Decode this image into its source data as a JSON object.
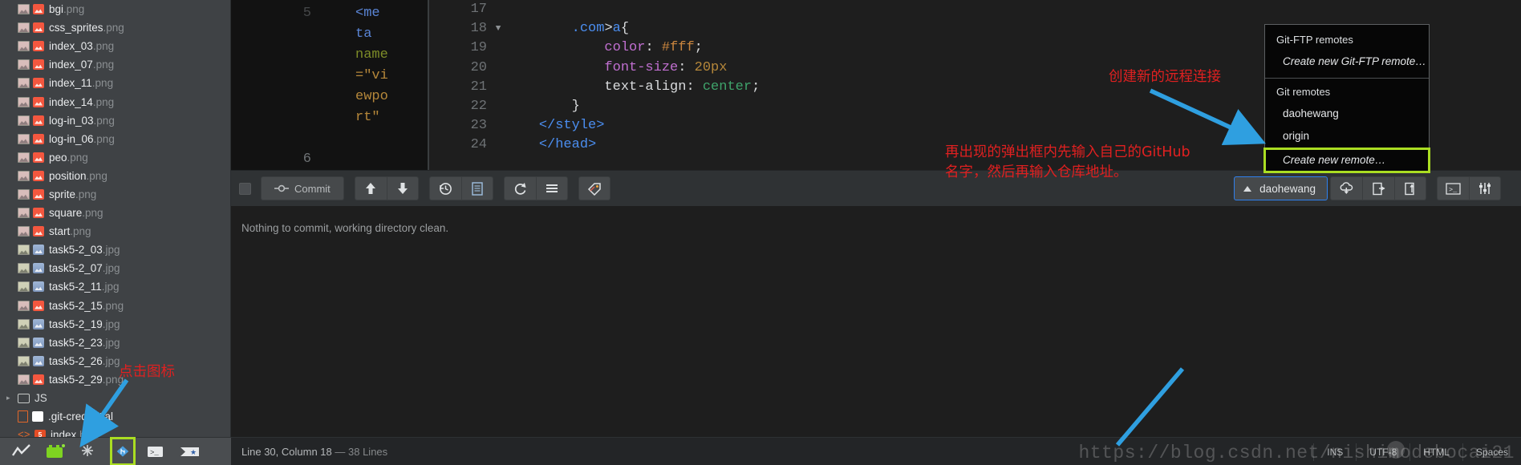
{
  "sidebar": {
    "files": [
      {
        "arrow": "",
        "icon": "image-thumb",
        "badge": "png",
        "name": "bgi",
        "ext": ".png",
        "tone": "pink"
      },
      {
        "arrow": "",
        "icon": "image-thumb",
        "badge": "png",
        "name": "css_sprites",
        "ext": ".png",
        "tone": "pink"
      },
      {
        "arrow": "",
        "icon": "image-thumb",
        "badge": "png",
        "name": "index_03",
        "ext": ".png",
        "tone": "pink"
      },
      {
        "arrow": "",
        "icon": "image-thumb",
        "badge": "png",
        "name": "index_07",
        "ext": ".png",
        "tone": "pink"
      },
      {
        "arrow": "",
        "icon": "image-thumb",
        "badge": "png",
        "name": "index_11",
        "ext": ".png",
        "tone": "pink"
      },
      {
        "arrow": "",
        "icon": "image-thumb",
        "badge": "png",
        "name": "index_14",
        "ext": ".png",
        "tone": "pink"
      },
      {
        "arrow": "",
        "icon": "image-thumb",
        "badge": "png",
        "name": "log-in_03",
        "ext": ".png",
        "tone": "pink"
      },
      {
        "arrow": "",
        "icon": "image-thumb",
        "badge": "png",
        "name": "log-in_06",
        "ext": ".png",
        "tone": "pink"
      },
      {
        "arrow": "",
        "icon": "image-thumb",
        "badge": "png",
        "name": "peo",
        "ext": ".png",
        "tone": "pink"
      },
      {
        "arrow": "",
        "icon": "image-thumb",
        "badge": "png",
        "name": "position",
        "ext": ".png",
        "tone": "pink"
      },
      {
        "arrow": "",
        "icon": "image-thumb",
        "badge": "png",
        "name": "sprite",
        "ext": ".png",
        "tone": "pink"
      },
      {
        "arrow": "",
        "icon": "image-thumb",
        "badge": "png",
        "name": "square",
        "ext": ".png",
        "tone": "pink"
      },
      {
        "arrow": "",
        "icon": "image-thumb",
        "badge": "png",
        "name": "start",
        "ext": ".png",
        "tone": "pink"
      },
      {
        "arrow": "",
        "icon": "image-thumb",
        "badge": "jpg",
        "name": "task5-2_03",
        "ext": ".jpg",
        "tone": "yellow"
      },
      {
        "arrow": "",
        "icon": "image-thumb",
        "badge": "jpg",
        "name": "task5-2_07",
        "ext": ".jpg",
        "tone": "yellow"
      },
      {
        "arrow": "",
        "icon": "image-thumb",
        "badge": "jpg",
        "name": "task5-2_11",
        "ext": ".jpg",
        "tone": "yellow"
      },
      {
        "arrow": "",
        "icon": "image-thumb",
        "badge": "png",
        "name": "task5-2_15",
        "ext": ".png",
        "tone": "pink"
      },
      {
        "arrow": "",
        "icon": "image-thumb",
        "badge": "jpg",
        "name": "task5-2_19",
        "ext": ".jpg",
        "tone": "yellow"
      },
      {
        "arrow": "",
        "icon": "image-thumb",
        "badge": "jpg",
        "name": "task5-2_23",
        "ext": ".jpg",
        "tone": "yellow"
      },
      {
        "arrow": "",
        "icon": "image-thumb",
        "badge": "jpg",
        "name": "task5-2_26",
        "ext": ".jpg",
        "tone": "yellow"
      },
      {
        "arrow": "",
        "icon": "image-thumb",
        "badge": "png",
        "name": "task5-2_29",
        "ext": ".png",
        "tone": "pink"
      }
    ],
    "folder": {
      "arrow": "▸",
      "name": "JS"
    },
    "credential": {
      "name": ".git-credential",
      "ext": ""
    },
    "index_html": {
      "name": "index",
      "ext": ".html",
      "badge_label": "5"
    },
    "icon_bar": [
      {
        "name": "activity-graph-icon"
      },
      {
        "name": "terminal-green-icon"
      },
      {
        "name": "snowflake-icon"
      },
      {
        "name": "git-branch-icon"
      },
      {
        "name": "command-prompt-icon"
      },
      {
        "name": "send-flag-icon"
      }
    ]
  },
  "editor": {
    "left_pane": {
      "gutter_top": "5",
      "gutter_bottom": "6",
      "wrapped_tokens": [
        {
          "t": "<me",
          "c": "tag"
        },
        {
          "t": "ta",
          "c": "tag"
        },
        {
          "t": "name",
          "c": "attr"
        },
        {
          "t": "=\"vi",
          "c": "str"
        },
        {
          "t": "ewpo",
          "c": "str"
        },
        {
          "t": "rt\"",
          "c": "str"
        }
      ]
    },
    "lines": [
      {
        "num": "17",
        "fold": "",
        "segments": []
      },
      {
        "num": "18",
        "fold": "▼",
        "segments": [
          {
            "t": "        ",
            "c": "plain"
          },
          {
            "t": ".com",
            "c": "sel"
          },
          {
            "t": ">",
            "c": "plain"
          },
          {
            "t": "a",
            "c": "sel"
          },
          {
            "t": "{",
            "c": "plain"
          }
        ]
      },
      {
        "num": "19",
        "fold": "",
        "segments": [
          {
            "t": "            ",
            "c": "plain"
          },
          {
            "t": "color",
            "c": "prop"
          },
          {
            "t": ": ",
            "c": "plain"
          },
          {
            "t": "#fff",
            "c": "hash"
          },
          {
            "t": ";",
            "c": "plain"
          }
        ]
      },
      {
        "num": "20",
        "fold": "",
        "segments": [
          {
            "t": "            ",
            "c": "plain"
          },
          {
            "t": "font-size",
            "c": "prop"
          },
          {
            "t": ": ",
            "c": "plain"
          },
          {
            "t": "20px",
            "c": "valnum"
          }
        ]
      },
      {
        "num": "21",
        "fold": "",
        "segments": [
          {
            "t": "            ",
            "c": "plain"
          },
          {
            "t": "text-align",
            "c": "plain"
          },
          {
            "t": ": ",
            "c": "plain"
          },
          {
            "t": "center",
            "c": "valkw"
          },
          {
            "t": ";",
            "c": "plain"
          }
        ]
      },
      {
        "num": "22",
        "fold": "",
        "segments": [
          {
            "t": "        }",
            "c": "plain"
          }
        ]
      },
      {
        "num": "23",
        "fold": "",
        "segments": [
          {
            "t": "    ",
            "c": "plain"
          },
          {
            "t": "</style>",
            "c": "sel"
          }
        ]
      },
      {
        "num": "24",
        "fold": "",
        "segments": [
          {
            "t": "    ",
            "c": "plain"
          },
          {
            "t": "</head>",
            "c": "sel"
          }
        ]
      }
    ]
  },
  "git_toolbar": {
    "commit_label": "Commit",
    "buttons": [
      {
        "name": "stage-checkbox",
        "icon": "checkbox-icon"
      },
      {
        "name": "commit-button",
        "icon": "commit-node-icon"
      },
      {
        "name": "push-button",
        "icon": "arrow-up-icon"
      },
      {
        "name": "pull-button",
        "icon": "arrow-down-icon"
      },
      {
        "name": "history-button",
        "icon": "history-clock-icon"
      },
      {
        "name": "diff-button",
        "icon": "document-icon"
      },
      {
        "name": "refresh-button",
        "icon": "refresh-icon"
      },
      {
        "name": "menu-button",
        "icon": "hamburger-icon"
      },
      {
        "name": "tag-button",
        "icon": "tag-icon"
      }
    ],
    "branch_button": {
      "label": "daohewang",
      "icon": "chevron-up-icon"
    },
    "right_buttons": [
      {
        "name": "cloud-download-button",
        "icon": "cloud-download-icon"
      },
      {
        "name": "stash-out-button",
        "icon": "document-out-icon"
      },
      {
        "name": "stash-in-button",
        "icon": "document-in-icon"
      },
      {
        "name": "console-button",
        "icon": "terminal-icon"
      },
      {
        "name": "settings-button",
        "icon": "sliders-icon"
      }
    ]
  },
  "commit_area": {
    "message": "Nothing to commit, working directory clean."
  },
  "remote_menu": {
    "gitftp_header": "Git-FTP remotes",
    "gitftp_create": "Create new Git-FTP remote…",
    "git_header": "Git remotes",
    "remotes": [
      "daohewang",
      "origin"
    ],
    "create_remote": "Create new remote…",
    "highlight_color": "#aadd22"
  },
  "annotations": {
    "create_remote_note": "创建新的远程连接",
    "input_note": "再出现的弹出框内先输入自己的GitHub\n名字，然后再输入仓库地址。",
    "click_icon_note": "点击图标",
    "arrow_color": "#2f9fe0",
    "text_color": "#e02020"
  },
  "statusbar": {
    "position": "Line 30, Column 18",
    "separator": "—",
    "lines": "38 Lines",
    "items": [
      "INS",
      "UTF-8",
      "HTML",
      "Spaces"
    ]
  },
  "watermark": {
    "text": "https://blog.csdn.net/nishimodebocai21"
  }
}
